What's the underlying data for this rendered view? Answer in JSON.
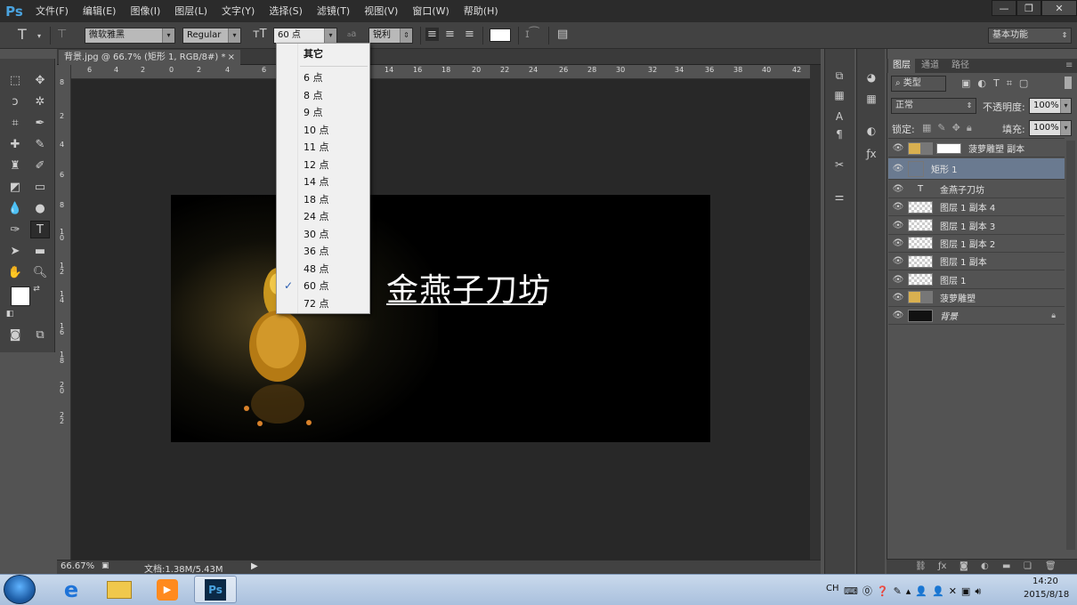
{
  "app": {
    "logo": "Ps"
  },
  "menu": [
    "文件(F)",
    "编辑(E)",
    "图像(I)",
    "图层(L)",
    "文字(Y)",
    "选择(S)",
    "滤镜(T)",
    "视图(V)",
    "窗口(W)",
    "帮助(H)"
  ],
  "window_controls": {
    "minimize": "—",
    "restore": "❐",
    "close": "✕"
  },
  "options": {
    "font_family": "微软雅黑",
    "font_style": "Regular",
    "font_size": "60 点",
    "aa_label": "a",
    "antialias": "锐利",
    "workspace": "基本功能"
  },
  "document": {
    "tab_title": "背景.jpg @ 66.7% (矩形 1, RGB/8#) *",
    "tab_close": "×",
    "zoom": "66.67%",
    "doc_info": "文档:1.38M/5.43M",
    "headline": "金燕子刀坊"
  },
  "hruler": [
    "6",
    "4",
    "2",
    "0",
    "2",
    "4",
    "6",
    "14",
    "16",
    "18",
    "20",
    "22",
    "24",
    "26",
    "28",
    "30",
    "32",
    "34",
    "36",
    "38",
    "40",
    "42"
  ],
  "vruler": [
    "8",
    "2",
    "4",
    "6",
    "8",
    "1 0",
    "1 2",
    "1 4",
    "1 6",
    "1 8",
    "2 0",
    "2 2"
  ],
  "size_dropdown": {
    "header": "其它",
    "items": [
      "6 点",
      "8 点",
      "9 点",
      "10 点",
      "11 点",
      "12 点",
      "14 点",
      "18 点",
      "24 点",
      "30 点",
      "36 点",
      "48 点",
      "60 点",
      "72 点"
    ],
    "selected": "60 点"
  },
  "layers_panel": {
    "tabs": [
      "图层",
      "通道",
      "路径"
    ],
    "filter_kind": "类型",
    "blend_mode": "正常",
    "opacity_label": "不透明度:",
    "opacity": "100%",
    "lock_label": "锁定:",
    "fill_label": "填充:",
    "fill": "100%",
    "layers": [
      {
        "name": "菠萝雕塑 副本",
        "kind": "smart-mask",
        "selected": false
      },
      {
        "name": "矩形 1",
        "kind": "shape",
        "selected": true
      },
      {
        "name": "金燕子刀坊",
        "kind": "text",
        "selected": false
      },
      {
        "name": "图层 1 副本 4",
        "kind": "pixel",
        "selected": false
      },
      {
        "name": "图层 1 副本 3",
        "kind": "pixel",
        "selected": false
      },
      {
        "name": "图层 1 副本 2",
        "kind": "pixel",
        "selected": false
      },
      {
        "name": "图层 1 副本",
        "kind": "pixel",
        "selected": false
      },
      {
        "name": "图层 1",
        "kind": "pixel",
        "selected": false
      },
      {
        "name": "菠萝雕塑",
        "kind": "smart",
        "selected": false
      },
      {
        "name": "背景",
        "kind": "background",
        "selected": false
      }
    ]
  },
  "taskbar": {
    "lang": "CH",
    "time": "14:20",
    "date": "2015/8/18"
  },
  "colors": {
    "accent": "#4aa3df",
    "selected_layer": "#6a7a90",
    "check": "#2a5db0"
  }
}
